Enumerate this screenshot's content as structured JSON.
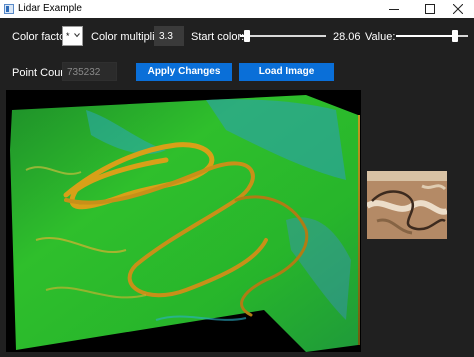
{
  "window": {
    "title": "Lidar Example",
    "icon": "app-window-icon",
    "controls": [
      "minimize-icon",
      "maximize-icon",
      "close-icon"
    ]
  },
  "toolbar": {
    "color_factor_label": "Color factor",
    "color_factor_value": "*",
    "color_multiplier_label": "Color multiplier",
    "color_multiplier_value": "3.3",
    "start_color_label": "Start color:",
    "start_color_value": "28.06",
    "start_color_fraction": 0.05,
    "value_label": "Value:",
    "value_fraction": 0.85
  },
  "controls": {
    "point_count_label": "Point Count:",
    "point_count_value": "735232",
    "apply_label": "Apply Changes",
    "load_label": "Load Image"
  },
  "colors": {
    "background": "#202020",
    "accent_button": "#0a6fd8",
    "terrain_low": "#d6a020",
    "terrain_mid": "#2bb82a",
    "terrain_high": "#27a6c8"
  }
}
